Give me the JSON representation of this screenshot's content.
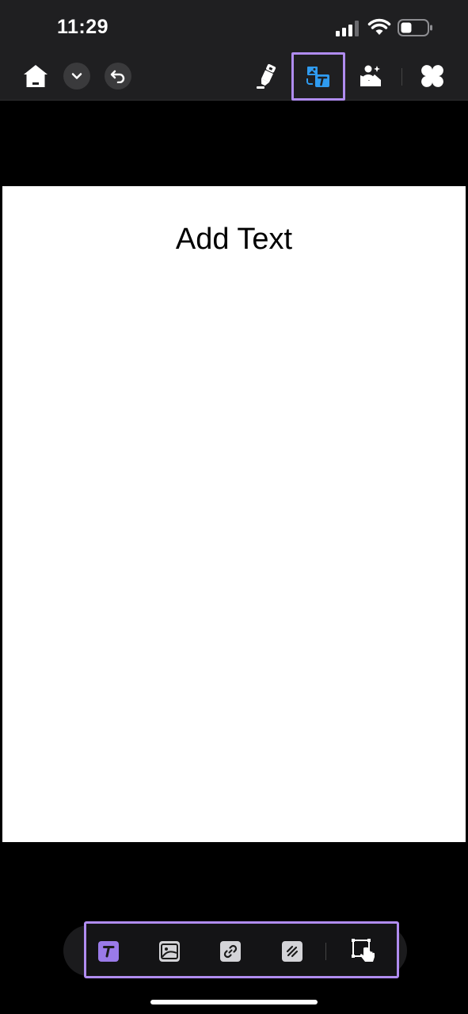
{
  "status_bar": {
    "time": "11:29",
    "icons": [
      "signal-icon",
      "wifi-icon",
      "battery-icon"
    ]
  },
  "toolbar": {
    "left_icons": [
      "home-icon",
      "chevron-down-icon",
      "undo-icon"
    ],
    "right_icons": [
      "highlighter-icon",
      "edit-text-image-icon",
      "ai-image-icon",
      "apps-grid-icon"
    ],
    "accent_color": "#b08cf0",
    "active_icon_color": "#2f9bf0"
  },
  "page": {
    "text": "Add Text"
  },
  "bottom_toolbar": {
    "icons": [
      "add-text-icon",
      "add-image-icon",
      "add-link-icon",
      "markup-icon",
      "select-area-icon"
    ],
    "active_color": "#9a7ae8"
  }
}
